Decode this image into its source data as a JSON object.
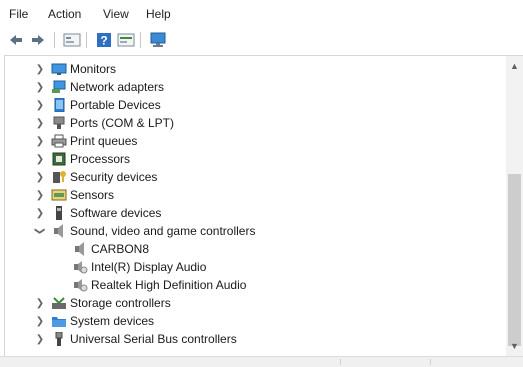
{
  "menu": {
    "file": "File",
    "action": "Action",
    "view": "View",
    "help": "Help"
  },
  "toolbar": {
    "back_icon": "back-arrow-icon",
    "forward_icon": "forward-arrow-icon",
    "properties_icon": "properties-icon",
    "help_icon": "help-icon",
    "update_icon": "update-driver-icon",
    "scan_icon": "scan-hardware-icon"
  },
  "tree": {
    "monitors": "Monitors",
    "network_adapters": "Network adapters",
    "portable_devices": "Portable Devices",
    "ports": "Ports (COM & LPT)",
    "print_queues": "Print queues",
    "processors": "Processors",
    "security_devices": "Security devices",
    "sensors": "Sensors",
    "software_devices": "Software devices",
    "sound": "Sound, video and game controllers",
    "sound_children": [
      "CARBON8",
      "Intel(R) Display Audio",
      "Realtek High Definition Audio"
    ],
    "storage": "Storage controllers",
    "system_devices": "System devices",
    "usb": "Universal Serial Bus controllers"
  },
  "colors": {
    "accent_blue": "#2e7dd1",
    "selection": "#cce8ff"
  }
}
